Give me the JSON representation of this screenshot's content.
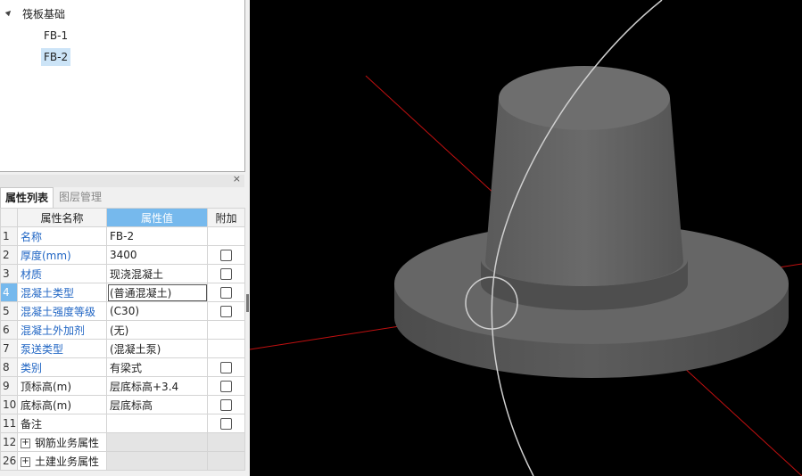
{
  "tree": {
    "root": "筏板基础",
    "children": [
      "FB-1",
      "FB-2"
    ],
    "selected": "FB-2"
  },
  "panel": {
    "close": "×",
    "tabs": [
      "属性列表",
      "图层管理"
    ]
  },
  "table": {
    "headers": [
      "属性名称",
      "属性值",
      "附加"
    ],
    "rows": [
      {
        "n": "1",
        "name": "名称",
        "value": "FB-2",
        "check": false
      },
      {
        "n": "2",
        "name": "厚度(mm)",
        "value": "3400",
        "check": true
      },
      {
        "n": "3",
        "name": "材质",
        "value": "现浇混凝土",
        "check": true
      },
      {
        "n": "4",
        "name": "混凝土类型",
        "value": "(普通混凝土)",
        "check": true
      },
      {
        "n": "5",
        "name": "混凝土强度等级",
        "value": "(C30)",
        "check": true
      },
      {
        "n": "6",
        "name": "混凝土外加剂",
        "value": "(无)",
        "check": false
      },
      {
        "n": "7",
        "name": "泵送类型",
        "value": "(混凝土泵)",
        "check": false
      },
      {
        "n": "8",
        "name": "类别",
        "value": "有梁式",
        "check": true
      },
      {
        "n": "9",
        "name": "顶标高(m)",
        "value": "层底标高+3.4",
        "check": true
      },
      {
        "n": "10",
        "name": "底标高(m)",
        "value": "层底标高",
        "check": true
      },
      {
        "n": "11",
        "name": "备注",
        "value": "",
        "check": true
      },
      {
        "n": "12",
        "name": "钢筋业务属性",
        "value": "",
        "check": false,
        "group": true
      },
      {
        "n": "26",
        "name": "土建业务属性",
        "value": "",
        "check": false,
        "group": true
      }
    ]
  },
  "colors": {
    "selected_header": "#76b9ed",
    "link_text": "#2166c4",
    "axis": "#c01010",
    "model": "#555555"
  }
}
